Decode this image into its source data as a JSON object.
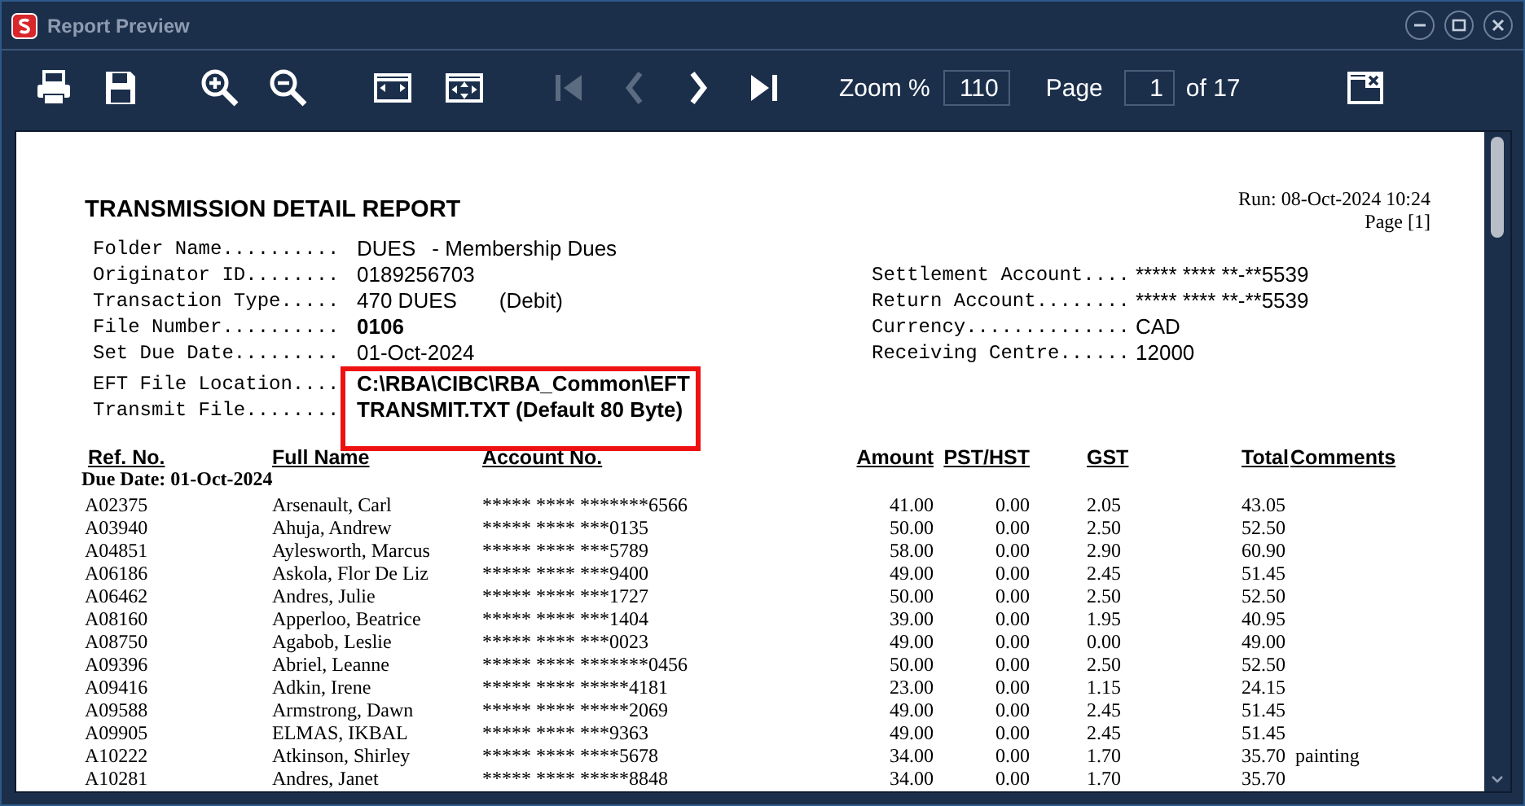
{
  "window": {
    "title": "Report Preview"
  },
  "toolbar": {
    "nav": [
      {
        "disabled": true
      },
      {
        "disabled": true
      },
      {
        "disabled": false
      },
      {
        "disabled": false
      }
    ],
    "zoom_label": "Zoom %",
    "zoom_value": "110",
    "page_label": "Page",
    "page_value": "1",
    "page_total": "of 17"
  },
  "report": {
    "title": "TRANSMISSION DETAIL REPORT",
    "run": "Run:  08-Oct-2024 10:24",
    "page": "Page [1]",
    "fields_left": [
      {
        "label": "Folder Name..........",
        "value": "DUES",
        "note": "- Membership Dues",
        "bold": false,
        "highlighted": false
      },
      {
        "label": "Originator ID........",
        "value": "0189256703",
        "bold": false,
        "highlighted": false
      },
      {
        "label": "Transaction Type.....",
        "value": "470 DUES",
        "note": "(Debit)",
        "bold": false,
        "highlighted": false
      },
      {
        "label": "File Number..........",
        "value": "0106",
        "bold": true,
        "highlighted": false
      },
      {
        "label": "Set Due Date.........",
        "value": "01-Oct-2024",
        "bold": false,
        "highlighted": false
      },
      {
        "label": "EFT File Location....",
        "value": "C:\\RBA\\CIBC\\RBA_Common\\EFT",
        "bold": true,
        "highlighted": true
      },
      {
        "label": "Transmit File........",
        "value": "TRANSMIT.TXT (Default 80 Byte)",
        "bold": true,
        "highlighted": true
      }
    ],
    "fields_right": [
      {
        "label": "Settlement Account....",
        "value": "***** **** **-**5539"
      },
      {
        "label": "Return Account........",
        "value": "***** **** **-**5539"
      },
      {
        "label": "Currency..............",
        "value": "CAD"
      },
      {
        "label": "Receiving Centre......",
        "value": "12000"
      }
    ],
    "columns": [
      "Ref. No.",
      "Full Name",
      "Account No.",
      "Amount",
      "PST/HST",
      "GST",
      "Total",
      "Comments"
    ],
    "group": "Due Date: 01-Oct-2024",
    "rows": [
      {
        "ref": "A02375",
        "name": "Arsenault, Carl",
        "account": "***** **** *******6566",
        "amount": "41.00",
        "pst_hst": "0.00",
        "gst": "2.05",
        "total": "43.05"
      },
      {
        "ref": "A03940",
        "name": "Ahuja, Andrew",
        "account": "***** **** ***0135",
        "amount": "50.00",
        "pst_hst": "0.00",
        "gst": "2.50",
        "total": "52.50"
      },
      {
        "ref": "A04851",
        "name": "Aylesworth, Marcus",
        "account": "***** **** ***5789",
        "amount": "58.00",
        "pst_hst": "0.00",
        "gst": "2.90",
        "total": "60.90"
      },
      {
        "ref": "A06186",
        "name": "Askola, Flor De Liz",
        "account": "***** **** ***9400",
        "amount": "49.00",
        "pst_hst": "0.00",
        "gst": "2.45",
        "total": "51.45"
      },
      {
        "ref": "A06462",
        "name": "Andres, Julie",
        "account": "***** **** ***1727",
        "amount": "50.00",
        "pst_hst": "0.00",
        "gst": "2.50",
        "total": "52.50"
      },
      {
        "ref": "A08160",
        "name": "Apperloo, Beatrice",
        "account": "***** **** ***1404",
        "amount": "39.00",
        "pst_hst": "0.00",
        "gst": "1.95",
        "total": "40.95"
      },
      {
        "ref": "A08750",
        "name": "Agabob, Leslie",
        "account": "***** **** ***0023",
        "amount": "49.00",
        "pst_hst": "0.00",
        "gst": "0.00",
        "total": "49.00"
      },
      {
        "ref": "A09396",
        "name": "Abriel, Leanne",
        "account": "***** **** *******0456",
        "amount": "50.00",
        "pst_hst": "0.00",
        "gst": "2.50",
        "total": "52.50"
      },
      {
        "ref": "A09416",
        "name": "Adkin, Irene",
        "account": "***** **** *****4181",
        "amount": "23.00",
        "pst_hst": "0.00",
        "gst": "1.15",
        "total": "24.15"
      },
      {
        "ref": "A09588",
        "name": "Armstrong, Dawn",
        "account": "***** **** *****2069",
        "amount": "49.00",
        "pst_hst": "0.00",
        "gst": "2.45",
        "total": "51.45"
      },
      {
        "ref": "A09905",
        "name": "ELMAS, IKBAL",
        "account": "***** **** ***9363",
        "amount": "49.00",
        "pst_hst": "0.00",
        "gst": "2.45",
        "total": "51.45"
      },
      {
        "ref": "A10222",
        "name": "Atkinson, Shirley",
        "account": "***** **** ****5678",
        "amount": "34.00",
        "pst_hst": "0.00",
        "gst": "1.70",
        "total": "35.70",
        "comment": "painting"
      },
      {
        "ref": "A10281",
        "name": "Andres, Janet",
        "account": "***** **** *****8848",
        "amount": "34.00",
        "pst_hst": "0.00",
        "gst": "1.70",
        "total": "35.70"
      }
    ]
  }
}
